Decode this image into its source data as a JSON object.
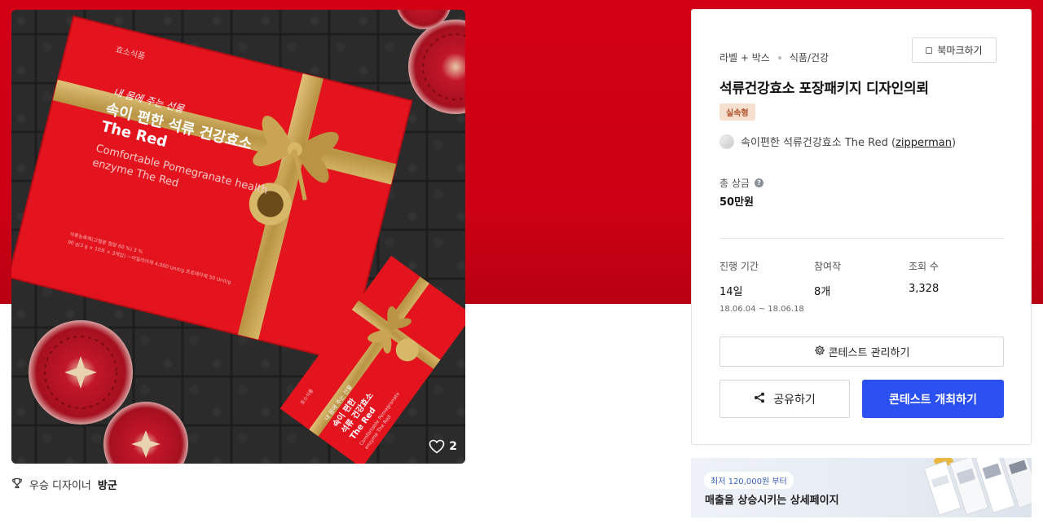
{
  "gallery": {
    "likes_count": "2",
    "winner_prefix": "우승 디자이너",
    "winner_name": "방군",
    "box_large": {
      "brand": "효소식품",
      "script": "내 몸에 주는 선물",
      "headline": "속이 편한 석류 건강효소",
      "name": "The Red",
      "eng_line1": "Comfortable Pomegranate health",
      "eng_line2": "enzyme The Red",
      "spec_line1": "석류농축액(고형분 함량 60 %) 3 %",
      "spec_line2": "90 g(3 g × 10포 × 3개입) ㅡ아밀라아제 4,000 Unit/g 프로테아제 50 Unit/g"
    },
    "box_small": {
      "brand": "효소식품",
      "script": "내 몸에 주는 선물",
      "headline_l1": "속이 편한",
      "headline_l2": "석류 건강효소",
      "name": "The Red",
      "eng_line1": "Comfortable Pomegranate",
      "eng_line2": "enzyme The Red"
    }
  },
  "contest": {
    "breadcrumb": [
      "라벨 + 박스",
      "식품/건강"
    ],
    "bookmark_label": "북마크하기",
    "title": "석류건강효소 포장패키지 디자인의뢰",
    "badge": "실속형",
    "client_text": "속이편한 석류건강효소 The Red (",
    "client_user": "zipperman",
    "client_close": ")",
    "prize_label": "총 상금",
    "prize_value": "50만원",
    "stats": {
      "period_label": "진행 기간",
      "period_value": "14일",
      "period_range": "18.06.04 ~ 18.06.18",
      "entries_label": "참여작",
      "entries_value": "8개",
      "views_label": "조회 수",
      "views_value": "3,328"
    },
    "manage_label": "콘테스트 관리하기",
    "share_label": "공유하기",
    "host_label": "콘테스트 개최하기"
  },
  "ad": {
    "pill": "최저 120,000원 부터",
    "text": "매출을 상승시키는 상세페이지"
  },
  "colors": {
    "brand_red": "#d20015",
    "primary_blue": "#2b50f2",
    "gold": "#c9a453",
    "badge_bg": "#f6dfcf",
    "badge_text": "#b0542a"
  },
  "icons": [
    "heart-icon",
    "trophy-icon",
    "bookmark-icon",
    "help-icon",
    "gear-icon",
    "share-icon",
    "avatar-icon"
  ]
}
